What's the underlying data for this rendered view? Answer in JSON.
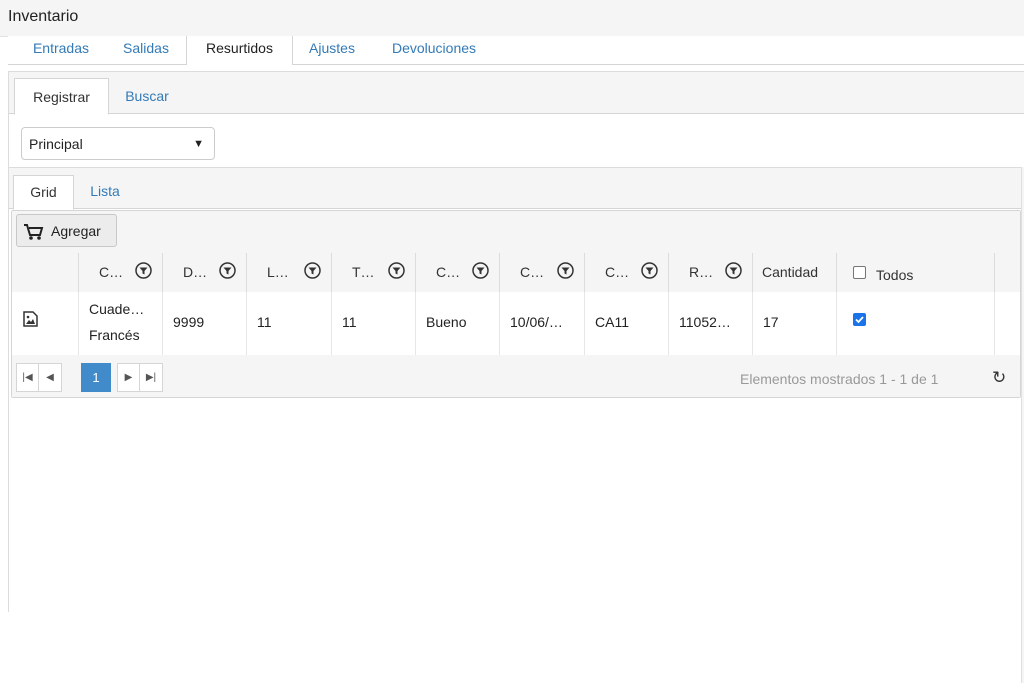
{
  "window": {
    "title": "Inventario"
  },
  "top_tabs": [
    {
      "label": "Entradas"
    },
    {
      "label": "Salidas"
    },
    {
      "label": "Resurtidos"
    },
    {
      "label": "Ajustes"
    },
    {
      "label": "Devoluciones"
    }
  ],
  "sub_tabs": [
    {
      "label": "Registrar"
    },
    {
      "label": "Buscar"
    }
  ],
  "warehouse_select": {
    "value": "Principal"
  },
  "view_tabs": [
    {
      "label": "Grid"
    },
    {
      "label": "Lista"
    }
  ],
  "toolbar": {
    "add_label": "Agregar"
  },
  "columns": [
    {
      "label": "C…"
    },
    {
      "label": "D…"
    },
    {
      "label": "L…"
    },
    {
      "label": "T…"
    },
    {
      "label": "C…"
    },
    {
      "label": "C…"
    },
    {
      "label": "C…"
    },
    {
      "label": "R…"
    },
    {
      "label": "Cantidad"
    },
    {
      "label": "Todos"
    }
  ],
  "rows": [
    {
      "c1_line1": "Cuade…",
      "c1_line2": "Francés",
      "c2": "9999",
      "c3": "11",
      "c4": "11",
      "c5": "Bueno",
      "c6": "10/06/…",
      "c7": "CA11",
      "c8": "11052…",
      "cantidad": "17",
      "selected": true
    }
  ],
  "pager": {
    "current_page": "1",
    "status": "Elementos mostrados 1 - 1 de 1"
  },
  "colors": {
    "accent": "#337ab7",
    "pager_active": "#428bca",
    "checkbox": "#1a73e8"
  }
}
